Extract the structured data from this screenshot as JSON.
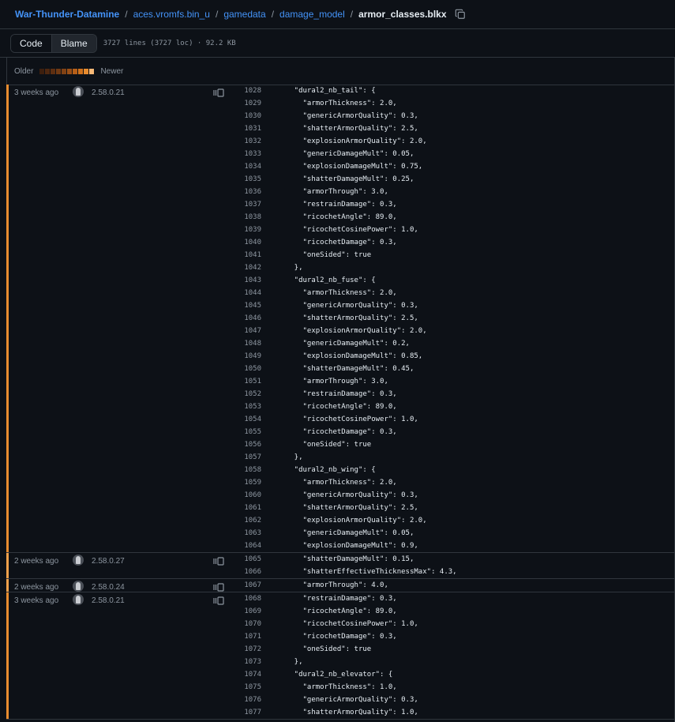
{
  "breadcrumb": {
    "repo": "War-Thunder-Datamine",
    "parts": [
      "aces.vromfs.bin_u",
      "gamedata",
      "damage_model"
    ],
    "file": "armor_classes.blkx"
  },
  "toolbar": {
    "code_label": "Code",
    "blame_label": "Blame",
    "file_info": "3727 lines (3727 loc) · 92.2 KB"
  },
  "legend": {
    "older": "Older",
    "newer": "Newer",
    "colors": [
      "#3d1f0e",
      "#4d2710",
      "#5e2f11",
      "#6f3913",
      "#824214",
      "#9a4f16",
      "#b65f18",
      "#d0721c",
      "#e88c2f",
      "#f7b977"
    ]
  },
  "hunks": [
    {
      "date": "3 weeks ago",
      "version": "2.58.0.21",
      "color": "#e88c2f",
      "lines": [
        {
          "n": "1028",
          "t": "    \"dural2_nb_tail\": {"
        },
        {
          "n": "1029",
          "t": "      \"armorThickness\": 2.0,"
        },
        {
          "n": "1030",
          "t": "      \"genericArmorQuality\": 0.3,"
        },
        {
          "n": "1031",
          "t": "      \"shatterArmorQuality\": 2.5,"
        },
        {
          "n": "1032",
          "t": "      \"explosionArmorQuality\": 2.0,"
        },
        {
          "n": "1033",
          "t": "      \"genericDamageMult\": 0.05,"
        },
        {
          "n": "1034",
          "t": "      \"explosionDamageMult\": 0.75,"
        },
        {
          "n": "1035",
          "t": "      \"shatterDamageMult\": 0.25,"
        },
        {
          "n": "1036",
          "t": "      \"armorThrough\": 3.0,"
        },
        {
          "n": "1037",
          "t": "      \"restrainDamage\": 0.3,"
        },
        {
          "n": "1038",
          "t": "      \"ricochetAngle\": 89.0,"
        },
        {
          "n": "1039",
          "t": "      \"ricochetCosinePower\": 1.0,"
        },
        {
          "n": "1040",
          "t": "      \"ricochetDamage\": 0.3,"
        },
        {
          "n": "1041",
          "t": "      \"oneSided\": true"
        },
        {
          "n": "1042",
          "t": "    },"
        },
        {
          "n": "1043",
          "t": "    \"dural2_nb_fuse\": {"
        },
        {
          "n": "1044",
          "t": "      \"armorThickness\": 2.0,"
        },
        {
          "n": "1045",
          "t": "      \"genericArmorQuality\": 0.3,"
        },
        {
          "n": "1046",
          "t": "      \"shatterArmorQuality\": 2.5,"
        },
        {
          "n": "1047",
          "t": "      \"explosionArmorQuality\": 2.0,"
        },
        {
          "n": "1048",
          "t": "      \"genericDamageMult\": 0.2,"
        },
        {
          "n": "1049",
          "t": "      \"explosionDamageMult\": 0.85,"
        },
        {
          "n": "1050",
          "t": "      \"shatterDamageMult\": 0.45,"
        },
        {
          "n": "1051",
          "t": "      \"armorThrough\": 3.0,"
        },
        {
          "n": "1052",
          "t": "      \"restrainDamage\": 0.3,"
        },
        {
          "n": "1053",
          "t": "      \"ricochetAngle\": 89.0,"
        },
        {
          "n": "1054",
          "t": "      \"ricochetCosinePower\": 1.0,"
        },
        {
          "n": "1055",
          "t": "      \"ricochetDamage\": 0.3,"
        },
        {
          "n": "1056",
          "t": "      \"oneSided\": true"
        },
        {
          "n": "1057",
          "t": "    },"
        },
        {
          "n": "1058",
          "t": "    \"dural2_nb_wing\": {"
        },
        {
          "n": "1059",
          "t": "      \"armorThickness\": 2.0,"
        },
        {
          "n": "1060",
          "t": "      \"genericArmorQuality\": 0.3,"
        },
        {
          "n": "1061",
          "t": "      \"shatterArmorQuality\": 2.5,"
        },
        {
          "n": "1062",
          "t": "      \"explosionArmorQuality\": 2.0,"
        },
        {
          "n": "1063",
          "t": "      \"genericDamageMult\": 0.05,"
        },
        {
          "n": "1064",
          "t": "      \"explosionDamageMult\": 0.9,"
        }
      ]
    },
    {
      "date": "2 weeks ago",
      "version": "2.58.0.27",
      "color": "#f0a04b",
      "lines": [
        {
          "n": "1065",
          "t": "      \"shatterDamageMult\": 0.15,"
        },
        {
          "n": "1066",
          "t": "      \"shatterEffectiveThicknessMax\": 4.3,"
        }
      ]
    },
    {
      "date": "2 weeks ago",
      "version": "2.58.0.24",
      "color": "#f0a04b",
      "lines": [
        {
          "n": "1067",
          "t": "      \"armorThrough\": 4.0,"
        }
      ]
    },
    {
      "date": "3 weeks ago",
      "version": "2.58.0.21",
      "color": "#e88c2f",
      "lines": [
        {
          "n": "1068",
          "t": "      \"restrainDamage\": 0.3,"
        },
        {
          "n": "1069",
          "t": "      \"ricochetAngle\": 89.0,"
        },
        {
          "n": "1070",
          "t": "      \"ricochetCosinePower\": 1.0,"
        },
        {
          "n": "1071",
          "t": "      \"ricochetDamage\": 0.3,"
        },
        {
          "n": "1072",
          "t": "      \"oneSided\": true"
        },
        {
          "n": "1073",
          "t": "    },"
        },
        {
          "n": "1074",
          "t": "    \"dural2_nb_elevator\": {"
        },
        {
          "n": "1075",
          "t": "      \"armorThickness\": 1.0,"
        },
        {
          "n": "1076",
          "t": "      \"genericArmorQuality\": 0.3,"
        },
        {
          "n": "1077",
          "t": "      \"shatterArmorQuality\": 1.0,"
        }
      ]
    }
  ]
}
